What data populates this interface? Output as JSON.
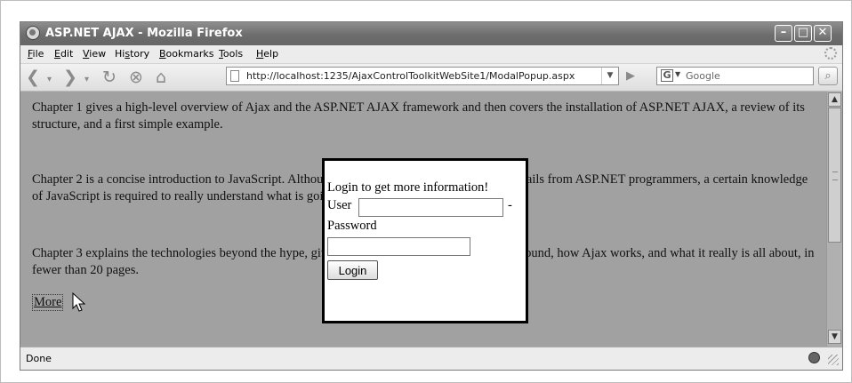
{
  "window": {
    "title": "ASP.NET AJAX - Mozilla Firefox",
    "controls": {
      "minimize": "–",
      "maximize": "□",
      "close": "✕"
    }
  },
  "menu": [
    {
      "label": "File",
      "key": "F"
    },
    {
      "label": "Edit",
      "key": "E"
    },
    {
      "label": "View",
      "key": "V"
    },
    {
      "label": "History",
      "key": "s"
    },
    {
      "label": "Bookmarks",
      "key": "B"
    },
    {
      "label": "Tools",
      "key": "T"
    },
    {
      "label": "Help",
      "key": "H"
    }
  ],
  "nav": {
    "back_icon": "back-arrow-icon",
    "forward_icon": "forward-arrow-icon",
    "reload_icon": "reload-icon",
    "stop_icon": "stop-icon",
    "home_icon": "home-icon",
    "url": "http://localhost:1235/AjaxControlToolkitWebSite1/ModalPopup.aspx",
    "search_placeholder": "Google"
  },
  "content": {
    "paragraphs": [
      "Chapter 1 gives a high-level overview of Ajax and the ASP.NET AJAX framework and then covers the installation of ASP.NET AJAX, a review of its structure, and a first simple example.",
      "Chapter 2 is a concise introduction to JavaScript. Although ASP.NET AJAX tries to hide the details from ASP.NET programmers, a certain knowledge of JavaScript is required to really understand what is going on.",
      "Chapter 3 explains the technologies beyond the hype, giving you a look at what is in the background, how Ajax works, and what it really is all about, in fewer than 20 pages."
    ],
    "more_link": "More"
  },
  "modal": {
    "title": "Login to get more information!",
    "user_label": "User",
    "user_value": "",
    "dash": "-",
    "password_label": "Password",
    "password_value": "",
    "login_button": "Login"
  },
  "status": {
    "text": "Done"
  }
}
